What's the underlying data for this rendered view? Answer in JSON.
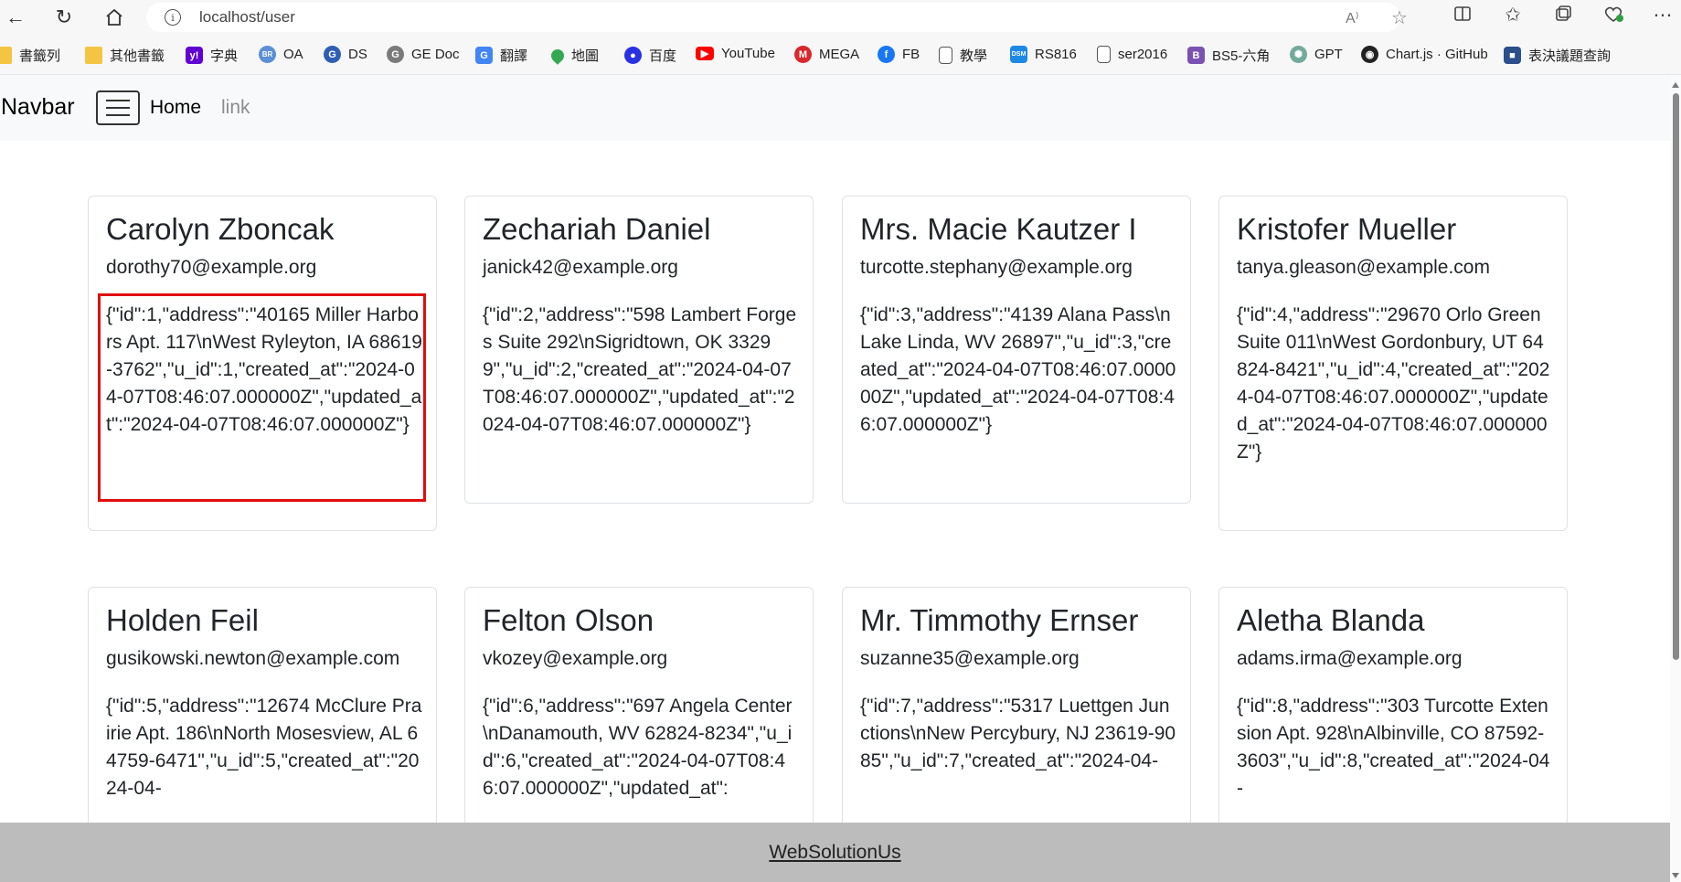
{
  "browser": {
    "url": "localhost/user",
    "info_symbol": "i",
    "read_aloud_symbol": "A⁾"
  },
  "bookmarks": [
    {
      "label": "書籤列",
      "icon": "folder-icon",
      "color": "#f4c542"
    },
    {
      "label": "其他書籤",
      "icon": "folder-icon",
      "color": "#f4c542"
    },
    {
      "label": "字典",
      "icon": "yahoo-icon",
      "color": "#6001d2"
    },
    {
      "label": "OA",
      "icon": "oa-icon",
      "color": "#5b8fd6"
    },
    {
      "label": "DS",
      "icon": "ge-icon",
      "color": "#2f5fb3"
    },
    {
      "label": "GE Doc",
      "icon": "ge-doc-icon",
      "color": "#7a7a7a"
    },
    {
      "label": "翻譯",
      "icon": "translate-icon",
      "color": "#4285f4"
    },
    {
      "label": "地圖",
      "icon": "maps-pin-icon",
      "color": "#34a853"
    },
    {
      "label": "百度",
      "icon": "baidu-paw-icon",
      "color": "#2932e1"
    },
    {
      "label": "YouTube",
      "icon": "youtube-icon",
      "color": "#ff0000"
    },
    {
      "label": "MEGA",
      "icon": "mega-icon",
      "color": "#d9272e"
    },
    {
      "label": "FB",
      "icon": "facebook-icon",
      "color": "#1877f2"
    },
    {
      "label": "教學",
      "icon": "page-icon",
      "color": "#555555"
    },
    {
      "label": "RS816",
      "icon": "dsm-icon",
      "color": "#1e88e5"
    },
    {
      "label": "ser2016",
      "icon": "page-icon",
      "color": "#555555"
    },
    {
      "label": "BS5-六角",
      "icon": "bootstrap-icon",
      "color": "#7952b3"
    },
    {
      "label": "GPT",
      "icon": "openai-icon",
      "color": "#74aa9c"
    },
    {
      "label": "Chart.js · GitHub",
      "icon": "github-icon",
      "color": "#222222"
    },
    {
      "label": "表決議題查詢",
      "icon": "ly-icon",
      "color": "#2a4f8a"
    }
  ],
  "navbar": {
    "brand": "Navbar",
    "home": "Home",
    "link": "link"
  },
  "users": [
    {
      "name": "Carolyn Zboncak",
      "email": "dorothy70@example.org",
      "json": "{\"id\":1,\"address\":\"40165 Miller Harbors Apt. 117\\nWest Ryleyton, IA 68619-3762\",\"u_id\":1,\"created_at\":\"2024-04-07T08:46:07.000000Z\",\"updated_at\":\"2024-04-07T08:46:07.000000Z\"}"
    },
    {
      "name": "Zechariah Daniel",
      "email": "janick42@example.org",
      "json": "{\"id\":2,\"address\":\"598 Lambert Forges Suite 292\\nSigridtown, OK 33299\",\"u_id\":2,\"created_at\":\"2024-04-07T08:46:07.000000Z\",\"updated_at\":\"2024-04-07T08:46:07.000000Z\"}"
    },
    {
      "name": "Mrs. Macie Kautzer I",
      "email": "turcotte.stephany@example.org",
      "json": "{\"id\":3,\"address\":\"4139 Alana Pass\\nLake Linda, WV 26897\",\"u_id\":3,\"created_at\":\"2024-04-07T08:46:07.000000Z\",\"updated_at\":\"2024-04-07T08:46:07.000000Z\"}"
    },
    {
      "name": "Kristofer Mueller",
      "email": "tanya.gleason@example.com",
      "json": "{\"id\":4,\"address\":\"29670 Orlo Green Suite 011\\nWest Gordonbury, UT 64824-8421\",\"u_id\":4,\"created_at\":\"2024-04-07T08:46:07.000000Z\",\"updated_at\":\"2024-04-07T08:46:07.000000Z\"}"
    },
    {
      "name": "Holden Feil",
      "email": "gusikowski.newton@example.com",
      "json": "{\"id\":5,\"address\":\"12674 McClure Prairie Apt. 186\\nNorth Mosesview, AL 64759-6471\",\"u_id\":5,\"created_at\":\"2024-04-"
    },
    {
      "name": "Felton Olson",
      "email": "vkozey@example.org",
      "json": "{\"id\":6,\"address\":\"697 Angela Center\\nDanamouth, WV 62824-8234\",\"u_id\":6,\"created_at\":\"2024-04-07T08:46:07.000000Z\",\"updated_at\":"
    },
    {
      "name": "Mr. Timmothy Ernser",
      "email": "suzanne35@example.org",
      "json": "{\"id\":7,\"address\":\"5317 Luettgen Junctions\\nNew Percybury, NJ 23619-9085\",\"u_id\":7,\"created_at\":\"2024-04-"
    },
    {
      "name": "Aletha Blanda",
      "email": "adams.irma@example.org",
      "json": "{\"id\":8,\"address\":\"303 Turcotte Extension Apt. 928\\nAlbinville, CO 87592-3603\",\"u_id\":8,\"created_at\":\"2024-04-"
    }
  ],
  "footer": {
    "link": "WebSolutionUs"
  },
  "highlight_color": "#e00d0d"
}
